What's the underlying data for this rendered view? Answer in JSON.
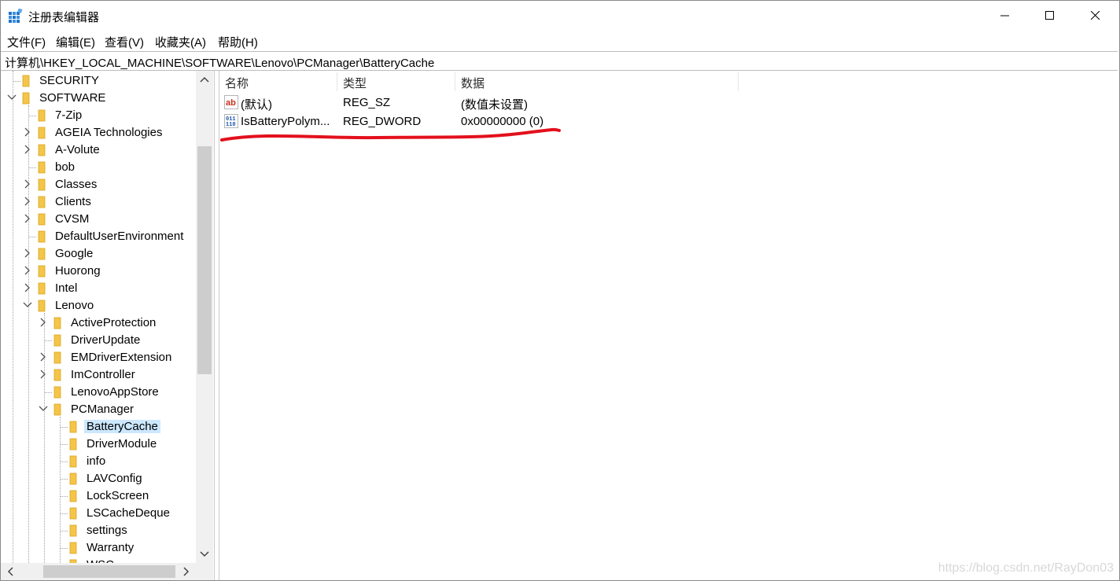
{
  "window": {
    "title": "注册表编辑器",
    "icon": "registry-editor-icon",
    "controls": [
      "minimize-icon",
      "maximize-icon",
      "close-icon"
    ]
  },
  "menu": [
    "文件(F)",
    "编辑(E)",
    "查看(V)",
    "收藏夹(A)",
    "帮助(H)"
  ],
  "address": "计算机\\HKEY_LOCAL_MACHINE\\SOFTWARE\\Lenovo\\PCManager\\BatteryCache",
  "tree": [
    {
      "label": "SECURITY",
      "level": 1,
      "expander": "none"
    },
    {
      "label": "SOFTWARE",
      "level": 1,
      "expander": "expanded"
    },
    {
      "label": "7-Zip",
      "level": 2,
      "expander": "none"
    },
    {
      "label": "AGEIA Technologies",
      "level": 2,
      "expander": "collapsed"
    },
    {
      "label": "A-Volute",
      "level": 2,
      "expander": "collapsed"
    },
    {
      "label": "bob",
      "level": 2,
      "expander": "none"
    },
    {
      "label": "Classes",
      "level": 2,
      "expander": "collapsed"
    },
    {
      "label": "Clients",
      "level": 2,
      "expander": "collapsed"
    },
    {
      "label": "CVSM",
      "level": 2,
      "expander": "collapsed"
    },
    {
      "label": "DefaultUserEnvironment",
      "level": 2,
      "expander": "none"
    },
    {
      "label": "Google",
      "level": 2,
      "expander": "collapsed"
    },
    {
      "label": "Huorong",
      "level": 2,
      "expander": "collapsed"
    },
    {
      "label": "Intel",
      "level": 2,
      "expander": "collapsed"
    },
    {
      "label": "Lenovo",
      "level": 2,
      "expander": "expanded"
    },
    {
      "label": "ActiveProtection",
      "level": 3,
      "expander": "collapsed"
    },
    {
      "label": "DriverUpdate",
      "level": 3,
      "expander": "none"
    },
    {
      "label": "EMDriverExtension",
      "level": 3,
      "expander": "collapsed"
    },
    {
      "label": "ImController",
      "level": 3,
      "expander": "collapsed"
    },
    {
      "label": "LenovoAppStore",
      "level": 3,
      "expander": "none"
    },
    {
      "label": "PCManager",
      "level": 3,
      "expander": "expanded"
    },
    {
      "label": "BatteryCache",
      "level": 4,
      "expander": "none",
      "selected": true
    },
    {
      "label": "DriverModule",
      "level": 4,
      "expander": "none"
    },
    {
      "label": "info",
      "level": 4,
      "expander": "none"
    },
    {
      "label": "LAVConfig",
      "level": 4,
      "expander": "none"
    },
    {
      "label": "LockScreen",
      "level": 4,
      "expander": "none"
    },
    {
      "label": "LSCacheDeque",
      "level": 4,
      "expander": "none"
    },
    {
      "label": "settings",
      "level": 4,
      "expander": "none"
    },
    {
      "label": "Warranty",
      "level": 4,
      "expander": "none"
    },
    {
      "label": "WSC",
      "level": 4,
      "expander": "none"
    }
  ],
  "columns": [
    "名称",
    "类型",
    "数据"
  ],
  "values": [
    {
      "icon": "string-value-icon",
      "name": "(默认)",
      "type": "REG_SZ",
      "data": "(数值未设置)"
    },
    {
      "icon": "binary-value-icon",
      "name": "IsBatteryPolym...",
      "type": "REG_DWORD",
      "data": "0x00000000 (0)"
    }
  ],
  "colors": {
    "selection": "#cce8ff",
    "annotation": "#e3101c",
    "folder": "#f4c548"
  },
  "watermark": "https://blog.csdn.net/RayDon03"
}
